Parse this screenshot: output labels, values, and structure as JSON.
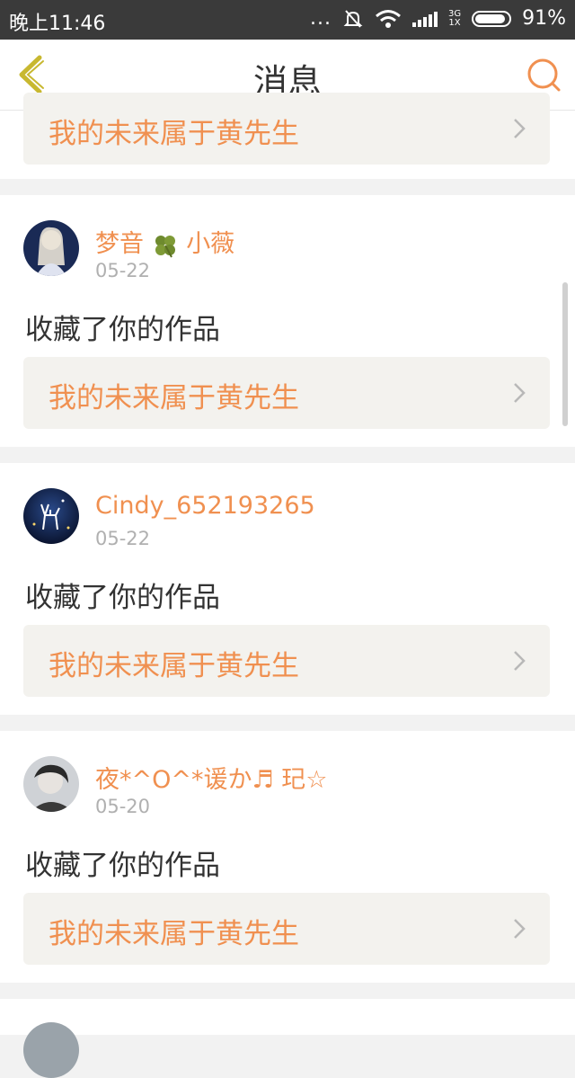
{
  "status_bar": {
    "time": "晚上11:46",
    "dots": "...",
    "network": "3G",
    "network_sub": "1X",
    "battery_percent": "91%",
    "battery_level": 0.91
  },
  "header": {
    "title": "消息",
    "back_icon": "chevron-left-icon",
    "search_icon": "search-icon"
  },
  "colors": {
    "accent": "#f09050",
    "back_icon": "#c8b830",
    "text": "#333333",
    "date": "#b0b0b0",
    "work_box_bg": "#f3f2ee"
  },
  "partial_top": {
    "work_title": "我的未来属于黄先生"
  },
  "messages": [
    {
      "name_a": "梦音",
      "name_b": "小薇",
      "date": "05-22",
      "action": "收藏了你的作品",
      "work_title": "我的未来属于黄先生"
    },
    {
      "name": "Cindy_652193265",
      "date": "05-22",
      "action": "收藏了你的作品",
      "work_title": "我的未来属于黄先生"
    },
    {
      "name": "夜*^O^*谖か♬ 玘☆",
      "date": "05-20",
      "action": "收藏了你的作品",
      "work_title": "我的未来属于黄先生"
    }
  ]
}
